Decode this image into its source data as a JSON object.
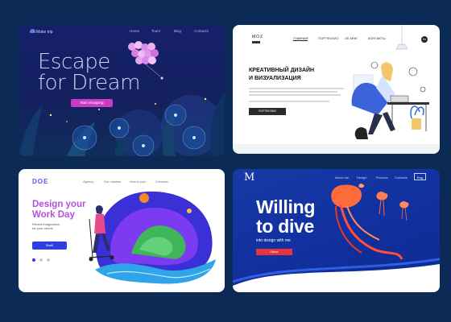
{
  "cards": [
    {
      "logo": "Make trip",
      "nav": [
        "Home",
        "Tours",
        "Blog",
        "Contacts"
      ],
      "headline_line1": "Escape",
      "headline_line2": "for Dream",
      "cta": "Start shopping"
    },
    {
      "logo": "MOZ",
      "nav": [
        "ГЛАВНАЯ",
        "ПОРТФОЛИО",
        "ОБ МНЕ",
        "КОНТАКТЫ"
      ],
      "avatar": "En",
      "headline_line1": "КРЕАТИВНЫЙ ДИЗАЙН",
      "headline_line2": "И ВИЗУАЛИЗАЦИЯ",
      "cta": "ПОРТФОЛИО"
    },
    {
      "logo": "DOE",
      "nav": [
        "Agency",
        "Our classes",
        "How to join",
        "Contacts"
      ],
      "headline_line1": "Design your",
      "headline_line2": "Work Day",
      "sub_line1": "Reveal imagination",
      "sub_line2": "for your needs",
      "cta": "Start!"
    },
    {
      "logo": "M",
      "nav": [
        "About me",
        "Design",
        "Process",
        "Contacts"
      ],
      "nav_box": "Eng",
      "headline_line1": "Willing",
      "headline_line2": "to dive",
      "subtitle": "into design with me",
      "cta": "Follow"
    }
  ],
  "colors": {
    "page_background": "#0b2a55",
    "card1_accent": "#c83cc6",
    "card2_accent": "#2a2a2a",
    "card3_accent": "#2d3fe0",
    "card3_heading": "#b44fe0",
    "card4_accent": "#e5343c"
  }
}
